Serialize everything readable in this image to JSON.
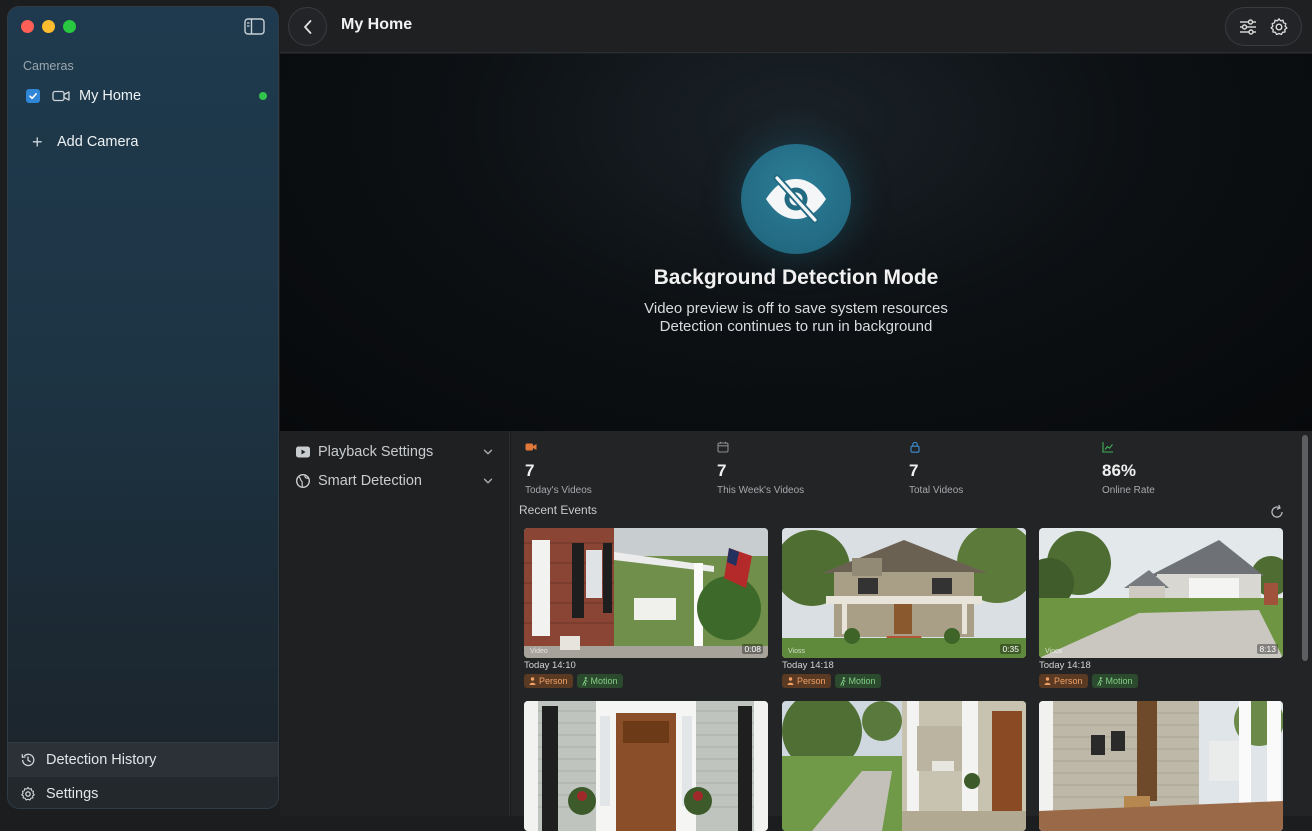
{
  "sidebar": {
    "section_label": "Cameras",
    "cameras": [
      {
        "name": "My Home",
        "checked": true,
        "status_color": "#30c24a"
      }
    ],
    "add_camera_label": "Add Camera",
    "bottom_nav": [
      {
        "label": "Detection History",
        "icon": "clock-history-icon",
        "active": true
      },
      {
        "label": "Settings",
        "icon": "gear-icon",
        "active": false
      }
    ]
  },
  "header": {
    "title": "My Home"
  },
  "preview": {
    "icon": "eye-slash-icon",
    "title": "Background Detection Mode",
    "line1": "Video preview is off to save system resources",
    "line2": "Detection continues to run in background"
  },
  "panel": {
    "sections": [
      {
        "label": "Playback Settings",
        "icon": "play-rect-icon"
      },
      {
        "label": "Smart Detection",
        "icon": "globe-icon"
      }
    ]
  },
  "stats": [
    {
      "value": "7",
      "caption": "Today's Videos",
      "icon": "video-icon",
      "color": "#e0783a"
    },
    {
      "value": "7",
      "caption": "This Week's Videos",
      "icon": "calendar-icon",
      "color": "#8a8d90"
    },
    {
      "value": "7",
      "caption": "Total Videos",
      "icon": "lock-icon",
      "color": "#3d8fd6"
    },
    {
      "value": "86%",
      "caption": "Online Rate",
      "icon": "chart-line-icon",
      "color": "#3fb15a"
    }
  ],
  "events": {
    "title": "Recent Events",
    "items": [
      {
        "time": "Today 14:10",
        "duration": "0:08",
        "stamp": "Video",
        "tags": [
          "Person",
          "Motion"
        ]
      },
      {
        "time": "Today 14:18",
        "duration": "0:35",
        "stamp": "Vioss",
        "tags": [
          "Person",
          "Motion"
        ]
      },
      {
        "time": "Today 14:18",
        "duration": "8:13",
        "stamp": "Vioos",
        "tags": [
          "Person",
          "Motion"
        ]
      },
      {
        "time": "",
        "duration": "",
        "stamp": "",
        "tags": []
      },
      {
        "time": "",
        "duration": "",
        "stamp": "",
        "tags": []
      },
      {
        "time": "",
        "duration": "",
        "stamp": "",
        "tags": []
      }
    ]
  }
}
